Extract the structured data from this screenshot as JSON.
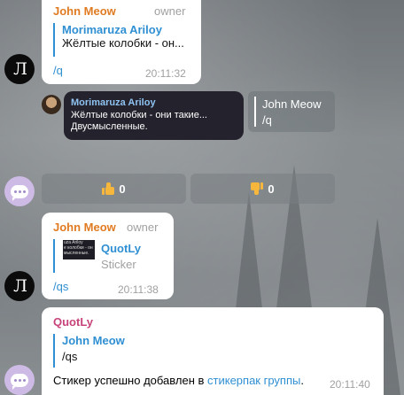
{
  "messages": {
    "m1": {
      "sender": "John Meow",
      "role": "owner",
      "quote_name": "Morimaruza Ariloy",
      "quote_text": "Жёлтые колобки - он...",
      "command": "/q",
      "time": "20:11:32",
      "avatar_text": "Л"
    },
    "m2": {
      "author": "Morimaruza Ariloy",
      "line1": "Жёлтые колобки - они такие...",
      "line2": "Двусмысленные.",
      "reply_name": "John Meow",
      "reply_text": "/q"
    },
    "reactions": {
      "like_count": "0",
      "dislike_count": "0"
    },
    "m3": {
      "sender": "John Meow",
      "role": "owner",
      "quote_name": "QuotLy",
      "quote_text": "Sticker",
      "thumb_lines": [
        "uza Ariloy",
        "е колобки - он",
        "мысленные."
      ],
      "command": "/qs",
      "time": "20:11:38",
      "avatar_text": "Л"
    },
    "m4": {
      "sender": "QuotLy",
      "quote_name": "John Meow",
      "quote_text": "/qs",
      "body_prefix": "Стикер успешно добавлен в ",
      "body_link": "стикерпак группы",
      "body_suffix": ".",
      "time": "20:11:40"
    }
  },
  "colors": {
    "sender_john": "#e07b22",
    "sender_quotly": "#c7437a",
    "link": "#2f8fd2",
    "dark_name": "#8ec3f2"
  }
}
